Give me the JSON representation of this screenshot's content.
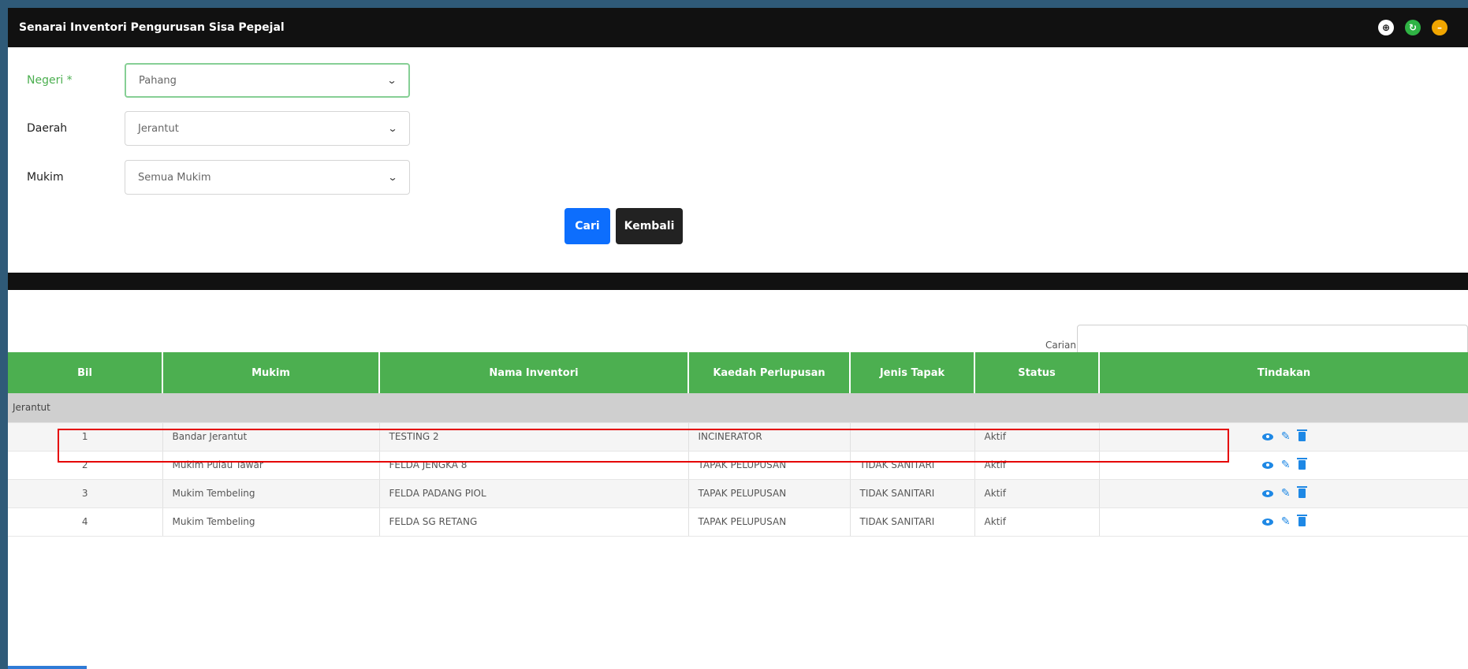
{
  "window": {
    "title": "Senarai Inventori Pengurusan Sisa Pepejal",
    "controls": [
      "expand-icon",
      "refresh-icon",
      "minimize-icon"
    ],
    "control_colors": {
      "refresh": "#2fb344",
      "minimize": "#f0a500"
    }
  },
  "filters": {
    "negeri": {
      "label": "Negeri *",
      "value": "Pahang"
    },
    "daerah": {
      "label": "Daerah",
      "value": "Jerantut"
    },
    "mukim": {
      "label": "Mukim",
      "value": "Semua Mukim"
    }
  },
  "buttons": {
    "cari": "Cari",
    "kembali": "Kembali"
  },
  "search": {
    "label": "Carian:",
    "value": ""
  },
  "table": {
    "columns": [
      "Bil",
      "Mukim",
      "Nama Inventori",
      "Kaedah Perlupusan",
      "Jenis Tapak",
      "Status",
      "Tindakan"
    ],
    "group": "Jerantut",
    "rows": [
      {
        "bil": "1",
        "mukim": "Bandar Jerantut",
        "nama": "TESTING 2",
        "kaedah": "INCINERATOR",
        "jenis": "",
        "status": "Aktif"
      },
      {
        "bil": "2",
        "mukim": "Mukim Pulau Tawar",
        "nama": "FELDA JENGKA 8",
        "kaedah": "TAPAK PELUPUSAN",
        "jenis": "TIDAK SANITARI",
        "status": "Aktif"
      },
      {
        "bil": "3",
        "mukim": "Mukim Tembeling",
        "nama": "FELDA PADANG PIOL",
        "kaedah": "TAPAK PELUPUSAN",
        "jenis": "TIDAK SANITARI",
        "status": "Aktif"
      },
      {
        "bil": "4",
        "mukim": "Mukim Tembeling",
        "nama": "FELDA SG RETANG",
        "kaedah": "TAPAK PELUPUSAN",
        "jenis": "TIDAK SANITARI",
        "status": "Aktif"
      }
    ],
    "actions": [
      "view-icon",
      "edit-icon",
      "delete-icon"
    ]
  },
  "colors": {
    "header_bar": "#111111",
    "table_header": "#4caf50",
    "primary_button": "#0d6efd",
    "highlight": "#e50000",
    "action_icon": "#1e88e5"
  }
}
